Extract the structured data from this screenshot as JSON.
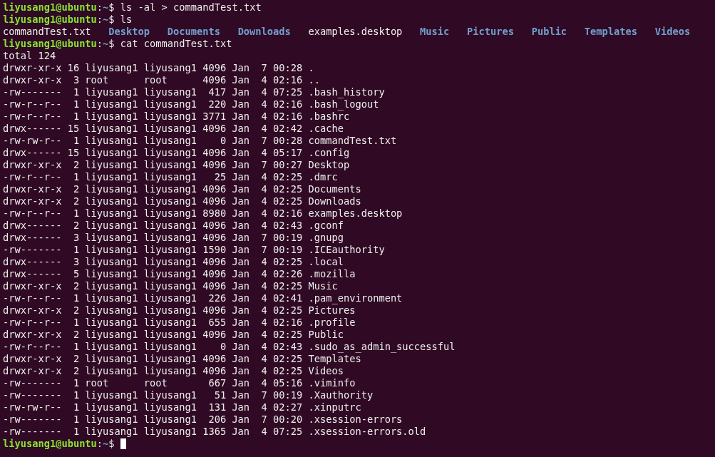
{
  "terminal": {
    "lines": [
      {
        "kind": "prompt",
        "user_host": "liyusang1@ubuntu",
        "separator": ":",
        "path": "~",
        "symbol": "$",
        "command": "ls -al > commandTest.txt"
      },
      {
        "kind": "prompt",
        "user_host": "liyusang1@ubuntu",
        "separator": ":",
        "path": "~",
        "symbol": "$",
        "command": "ls"
      },
      {
        "kind": "listing",
        "entries": [
          {
            "name": "commandTest.txt",
            "kind": "file"
          },
          {
            "name": "Desktop",
            "kind": "directory"
          },
          {
            "name": "Documents",
            "kind": "directory"
          },
          {
            "name": "Downloads",
            "kind": "directory"
          },
          {
            "name": "examples.desktop",
            "kind": "file"
          },
          {
            "name": "Music",
            "kind": "directory"
          },
          {
            "name": "Pictures",
            "kind": "directory"
          },
          {
            "name": "Public",
            "kind": "directory"
          },
          {
            "name": "Templates",
            "kind": "directory"
          },
          {
            "name": "Videos",
            "kind": "directory"
          }
        ]
      },
      {
        "kind": "prompt",
        "user_host": "liyusang1@ubuntu",
        "separator": ":",
        "path": "~",
        "symbol": "$",
        "command": "cat commandTest.txt"
      },
      {
        "kind": "output",
        "text": "total 124"
      },
      {
        "kind": "output",
        "text": "drwxr-xr-x 16 liyusang1 liyusang1 4096 Jan  7 00:28 ."
      },
      {
        "kind": "output",
        "text": "drwxr-xr-x  3 root      root      4096 Jan  4 02:16 .."
      },
      {
        "kind": "output",
        "text": "-rw-------  1 liyusang1 liyusang1  417 Jan  4 07:25 .bash_history"
      },
      {
        "kind": "output",
        "text": "-rw-r--r--  1 liyusang1 liyusang1  220 Jan  4 02:16 .bash_logout"
      },
      {
        "kind": "output",
        "text": "-rw-r--r--  1 liyusang1 liyusang1 3771 Jan  4 02:16 .bashrc"
      },
      {
        "kind": "output",
        "text": "drwx------ 15 liyusang1 liyusang1 4096 Jan  4 02:42 .cache"
      },
      {
        "kind": "output",
        "text": "-rw-rw-r--  1 liyusang1 liyusang1    0 Jan  7 00:28 commandTest.txt"
      },
      {
        "kind": "output",
        "text": "drwx------ 15 liyusang1 liyusang1 4096 Jan  4 05:17 .config"
      },
      {
        "kind": "output",
        "text": "drwxr-xr-x  2 liyusang1 liyusang1 4096 Jan  7 00:27 Desktop"
      },
      {
        "kind": "output",
        "text": "-rw-r--r--  1 liyusang1 liyusang1   25 Jan  4 02:25 .dmrc"
      },
      {
        "kind": "output",
        "text": "drwxr-xr-x  2 liyusang1 liyusang1 4096 Jan  4 02:25 Documents"
      },
      {
        "kind": "output",
        "text": "drwxr-xr-x  2 liyusang1 liyusang1 4096 Jan  4 02:25 Downloads"
      },
      {
        "kind": "output",
        "text": "-rw-r--r--  1 liyusang1 liyusang1 8980 Jan  4 02:16 examples.desktop"
      },
      {
        "kind": "output",
        "text": "drwx------  2 liyusang1 liyusang1 4096 Jan  4 02:43 .gconf"
      },
      {
        "kind": "output",
        "text": "drwx------  3 liyusang1 liyusang1 4096 Jan  7 00:19 .gnupg"
      },
      {
        "kind": "output",
        "text": "-rw-------  1 liyusang1 liyusang1 1590 Jan  7 00:19 .ICEauthority"
      },
      {
        "kind": "output",
        "text": "drwx------  3 liyusang1 liyusang1 4096 Jan  4 02:25 .local"
      },
      {
        "kind": "output",
        "text": "drwx------  5 liyusang1 liyusang1 4096 Jan  4 02:26 .mozilla"
      },
      {
        "kind": "output",
        "text": "drwxr-xr-x  2 liyusang1 liyusang1 4096 Jan  4 02:25 Music"
      },
      {
        "kind": "output",
        "text": "-rw-r--r--  1 liyusang1 liyusang1  226 Jan  4 02:41 .pam_environment"
      },
      {
        "kind": "output",
        "text": "drwxr-xr-x  2 liyusang1 liyusang1 4096 Jan  4 02:25 Pictures"
      },
      {
        "kind": "output",
        "text": "-rw-r--r--  1 liyusang1 liyusang1  655 Jan  4 02:16 .profile"
      },
      {
        "kind": "output",
        "text": "drwxr-xr-x  2 liyusang1 liyusang1 4096 Jan  4 02:25 Public"
      },
      {
        "kind": "output",
        "text": "-rw-r--r--  1 liyusang1 liyusang1    0 Jan  4 02:43 .sudo_as_admin_successful"
      },
      {
        "kind": "output",
        "text": "drwxr-xr-x  2 liyusang1 liyusang1 4096 Jan  4 02:25 Templates"
      },
      {
        "kind": "output",
        "text": "drwxr-xr-x  2 liyusang1 liyusang1 4096 Jan  4 02:25 Videos"
      },
      {
        "kind": "output",
        "text": "-rw-------  1 root      root       667 Jan  4 05:16 .viminfo"
      },
      {
        "kind": "output",
        "text": "-rw-------  1 liyusang1 liyusang1   51 Jan  7 00:19 .Xauthority"
      },
      {
        "kind": "output",
        "text": "-rw-rw-r--  1 liyusang1 liyusang1  131 Jan  4 02:27 .xinputrc"
      },
      {
        "kind": "output",
        "text": "-rw-------  1 liyusang1 liyusang1  206 Jan  7 00:20 .xsession-errors"
      },
      {
        "kind": "output",
        "text": "-rw-------  1 liyusang1 liyusang1 1365 Jan  4 07:25 .xsession-errors.old"
      },
      {
        "kind": "prompt",
        "user_host": "liyusang1@ubuntu",
        "separator": ":",
        "path": "~",
        "symbol": "$",
        "cursor": true
      }
    ]
  }
}
